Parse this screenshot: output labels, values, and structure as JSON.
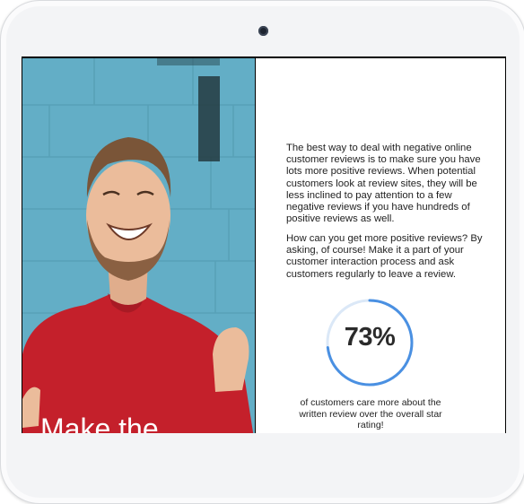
{
  "article": {
    "paragraph_1": "The best way to deal with negative online customer reviews is to make sure you have lots more positive reviews. When potential customers look at review sites, they will be less inclined to pay attention to a few negative reviews if you have hundreds of positive reviews as well.",
    "paragraph_2": "How can you get more positive reviews? By asking, of course! Make it a part of your customer interaction process and ask customers regularly to leave a review.",
    "stat": {
      "value_label": "73%",
      "fraction": 0.73,
      "caption": "of customers care more about the written review over the overall star rating!"
    }
  },
  "photo": {
    "headline": "Make the"
  },
  "colors": {
    "ring_accent": "#4a90e2",
    "ring_track": "#dbe8f7",
    "wall": "#63aec6",
    "shirt": "#c4202b"
  },
  "icons": {
    "camera": "front-camera-icon"
  }
}
